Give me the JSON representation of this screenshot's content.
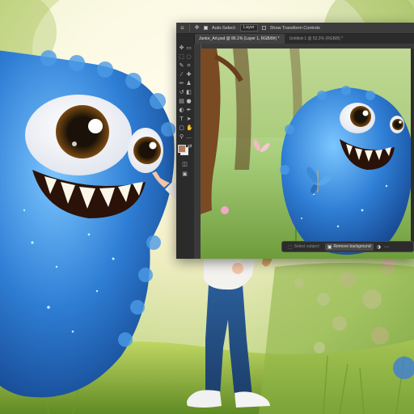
{
  "photoshop": {
    "options_bar": {
      "auto_select_label": "Auto-Select:",
      "auto_select_target": "Layer",
      "show_transform_label": "Show Transform Controls"
    },
    "tabs": [
      {
        "label": "Junior_Art.psd @ 86.1% (Layer 1, RGB/8#) *",
        "active": true
      },
      {
        "label": "Untitled-1 @ 52.3% (RGB/8) *",
        "active": false
      }
    ],
    "context_bar": {
      "select_subject": "Select subject",
      "remove_background": "Remove background"
    }
  },
  "colors": {
    "ui_dark": "#323232",
    "ui_panel": "#2b2b2b",
    "monster_blue": "#2f7fd6",
    "foreground_swatch": "#b0795c",
    "background_swatch": "#f2f2f2"
  },
  "icons": [
    "home-icon",
    "move-icon",
    "artboard-icon",
    "marquee-icon",
    "lasso-icon",
    "quick-select-icon",
    "crop-icon",
    "eyedropper-icon",
    "healing-icon",
    "brush-icon",
    "stamp-icon",
    "history-brush-icon",
    "eraser-icon",
    "gradient-icon",
    "blur-icon",
    "dodge-icon",
    "pen-icon",
    "type-icon",
    "path-select-icon",
    "shape-icon",
    "hand-icon",
    "zoom-icon",
    "swap-icon",
    "quick-mask-icon",
    "screen-mode-icon"
  ]
}
